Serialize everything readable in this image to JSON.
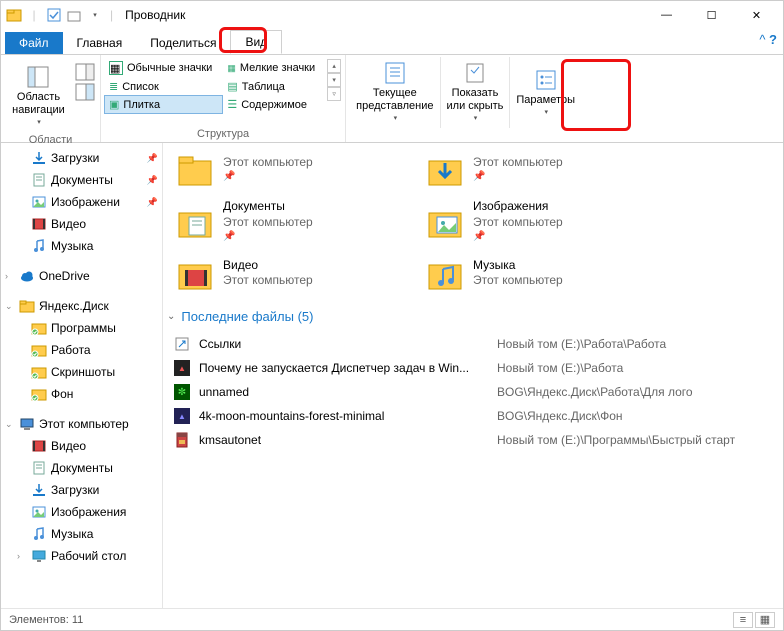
{
  "title": "Проводник",
  "tabs": {
    "file": "Файл",
    "home": "Главная",
    "share": "Поделиться",
    "view": "Вид"
  },
  "ribbon": {
    "panes_group": "Области",
    "nav_btn": "Область\nнавигации",
    "layout_group": "Структура",
    "layouts": {
      "normal_icons": "Обычные значки",
      "small_icons": "Мелкие значки",
      "list": "Список",
      "table": "Таблица",
      "tiles": "Плитка",
      "content": "Содержимое"
    },
    "current_view": "Текущее\nпредставление",
    "show_hide": "Показать\nили скрыть",
    "options": "Параметры"
  },
  "nav": [
    {
      "icon": "download",
      "label": "Загрузки",
      "pin": true,
      "indent": 1
    },
    {
      "icon": "doc",
      "label": "Документы",
      "pin": true,
      "indent": 1
    },
    {
      "icon": "pic",
      "label": "Изображени",
      "pin": true,
      "indent": 1
    },
    {
      "icon": "video",
      "label": "Видео",
      "indent": 1
    },
    {
      "icon": "music",
      "label": "Музыка",
      "indent": 1
    },
    {
      "spacer": true
    },
    {
      "icon": "cloud",
      "label": "OneDrive",
      "exp": true,
      "indent": 0
    },
    {
      "spacer": true
    },
    {
      "icon": "yfolder",
      "label": "Яндекс.Диск",
      "exp": true,
      "open": true,
      "indent": 0
    },
    {
      "icon": "gfolder",
      "label": "Программы",
      "indent": 1
    },
    {
      "icon": "gfolder",
      "label": "Работа",
      "indent": 1
    },
    {
      "icon": "gfolder",
      "label": "Скриншоты",
      "indent": 1
    },
    {
      "icon": "gfolder",
      "label": "Фон",
      "indent": 1
    },
    {
      "spacer": true
    },
    {
      "icon": "pc",
      "label": "Этот компьютер",
      "exp": true,
      "open": true,
      "indent": 0
    },
    {
      "icon": "video",
      "label": "Видео",
      "indent": 1
    },
    {
      "icon": "doc",
      "label": "Документы",
      "indent": 1
    },
    {
      "icon": "download",
      "label": "Загрузки",
      "indent": 1
    },
    {
      "icon": "pic",
      "label": "Изображения",
      "indent": 1
    },
    {
      "icon": "music",
      "label": "Музыка",
      "indent": 1
    },
    {
      "icon": "desktop",
      "label": "Рабочий стол",
      "exp": true,
      "indent": 1
    }
  ],
  "tiles": [
    {
      "icon": "folder",
      "name": "",
      "sub": "Этот компьютер",
      "pin": true
    },
    {
      "icon": "download-big",
      "name": "",
      "sub": "Этот компьютер",
      "pin": true
    },
    {
      "icon": "doc-big",
      "name": "Документы",
      "sub": "Этот компьютер",
      "pin": true
    },
    {
      "icon": "pic-big",
      "name": "Изображения",
      "sub": "Этот компьютер",
      "pin": true
    },
    {
      "icon": "video-big",
      "name": "Видео",
      "sub": "Этот компьютер"
    },
    {
      "icon": "music-big",
      "name": "Музыка",
      "sub": "Этот компьютер"
    }
  ],
  "recent": {
    "header": "Последние файлы (5)",
    "rows": [
      {
        "icon": "link",
        "name": "Ссылки",
        "loc": "Новый том (E:)\\Работа\\Работа"
      },
      {
        "icon": "img1",
        "name": "Почему не запускается Диспетчер задач в Win...",
        "loc": "Новый том (E:)\\Работа"
      },
      {
        "icon": "img2",
        "name": "unnamed",
        "loc": "BOG\\Яндекс.Диск\\Работа\\Для лого"
      },
      {
        "icon": "img3",
        "name": "4k-moon-mountains-forest-minimal",
        "loc": "BOG\\Яндекс.Диск\\Фон"
      },
      {
        "icon": "rar",
        "name": "kmsautonet",
        "loc": "Новый том (E:)\\Программы\\Быстрый старт"
      }
    ]
  },
  "status": "Элементов: 11"
}
